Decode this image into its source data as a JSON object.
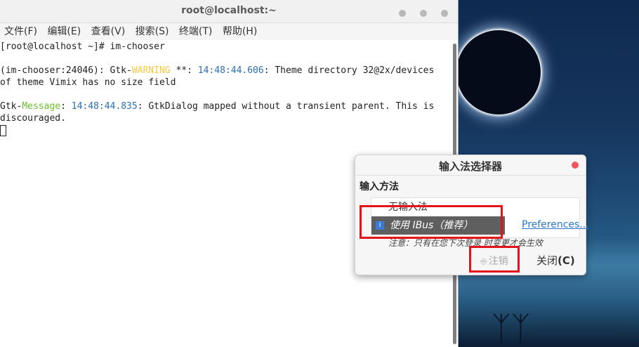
{
  "terminal": {
    "title": "root@localhost:~",
    "menu": [
      "文件(F)",
      "编辑(E)",
      "查看(V)",
      "搜索(S)",
      "终端(T)",
      "帮助(H)"
    ],
    "lines": {
      "l1": "[root@localhost ~]# im-chooser",
      "l2_prefix": "(im-chooser:24046): Gtk-",
      "l2_level": "WARNING",
      "l2_mid": " **: ",
      "l2_time": "14:48:44.606",
      "l2_rest": ": Theme directory 32@2x/devices",
      "l3": "of theme Vimix has no size field",
      "l4_prefix": "Gtk-",
      "l4_level": "Message",
      "l4_mid": ": ",
      "l4_time": "14:48:44.835",
      "l4_rest": ": GtkDialog mapped without a transient parent. This is",
      "l5": "discouraged."
    }
  },
  "dialog": {
    "title": "输入法选择器",
    "heading": "输入方法",
    "option_none": "无输入法",
    "option_ibus": "使用 IBus（推荐）",
    "preferences": "Preferences...",
    "note": "注意：只有在您下次登录 时变更才会生效",
    "logout": "注销",
    "close_label": "关闭",
    "close_key": "(C)"
  },
  "icons": {
    "info": "info-icon",
    "logout": "logout-icon",
    "close": "close-icon"
  },
  "colors": {
    "warning": "#f5c842",
    "message": "#6cbf2a",
    "timestamp": "#2a6fb5",
    "highlight": "#e4131b",
    "link": "#2a76d2"
  }
}
